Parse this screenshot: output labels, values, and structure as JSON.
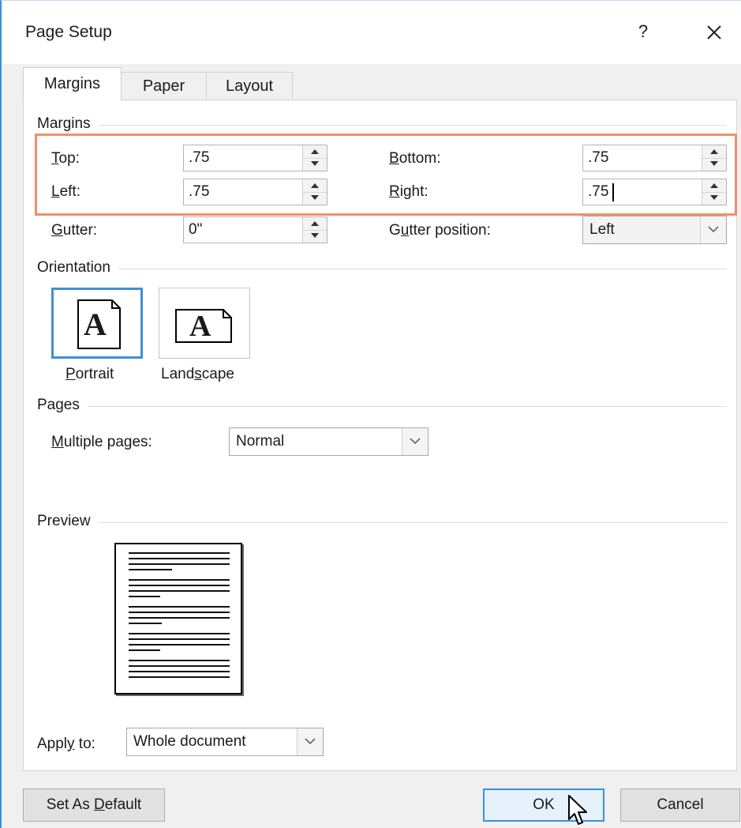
{
  "window": {
    "title": "Page Setup",
    "help_label": "?",
    "close_icon": "close-icon"
  },
  "tabs": [
    {
      "label": "Margins",
      "active": true
    },
    {
      "label": "Paper",
      "active": false
    },
    {
      "label": "Layout",
      "active": false
    }
  ],
  "margins": {
    "group_label": "Margins",
    "top": {
      "label_key": "T",
      "label_rest": "op:",
      "value": ".75"
    },
    "bottom": {
      "label_key": "B",
      "label_rest": "ottom:",
      "value": ".75"
    },
    "left": {
      "label_key": "L",
      "label_rest": "eft:",
      "value": ".75"
    },
    "right": {
      "label_key": "R",
      "label_rest": "ight:",
      "value": ".75"
    },
    "gutter": {
      "label_key": "G",
      "label_rest": "utter:",
      "value": "0\""
    },
    "gutter_position": {
      "label_pre": "G",
      "label_key": "u",
      "label_rest": "tter position:",
      "value": "Left"
    },
    "highlight_color": "#f0906a"
  },
  "orientation": {
    "group_label": "Orientation",
    "portrait": {
      "label_key": "P",
      "label_rest": "ortrait",
      "glyph": "A",
      "selected": true
    },
    "landscape": {
      "label_pre": "Land",
      "label_key": "s",
      "label_rest": "cape",
      "glyph": "A",
      "selected": false
    }
  },
  "pages": {
    "group_label": "Pages",
    "multiple_pages": {
      "label_key": "M",
      "label_rest": "ultiple pages:",
      "value": "Normal"
    }
  },
  "preview": {
    "group_label": "Preview"
  },
  "apply_to": {
    "label_pre": "Appl",
    "label_key": "y",
    "label_rest": " to:",
    "value": "Whole document"
  },
  "buttons": {
    "set_default": {
      "label_pre": "Set As ",
      "label_key": "D",
      "label_rest": "efault"
    },
    "ok": "OK",
    "cancel": "Cancel"
  },
  "colors": {
    "accent": "#3f8fd8",
    "highlight": "#f0906a"
  }
}
